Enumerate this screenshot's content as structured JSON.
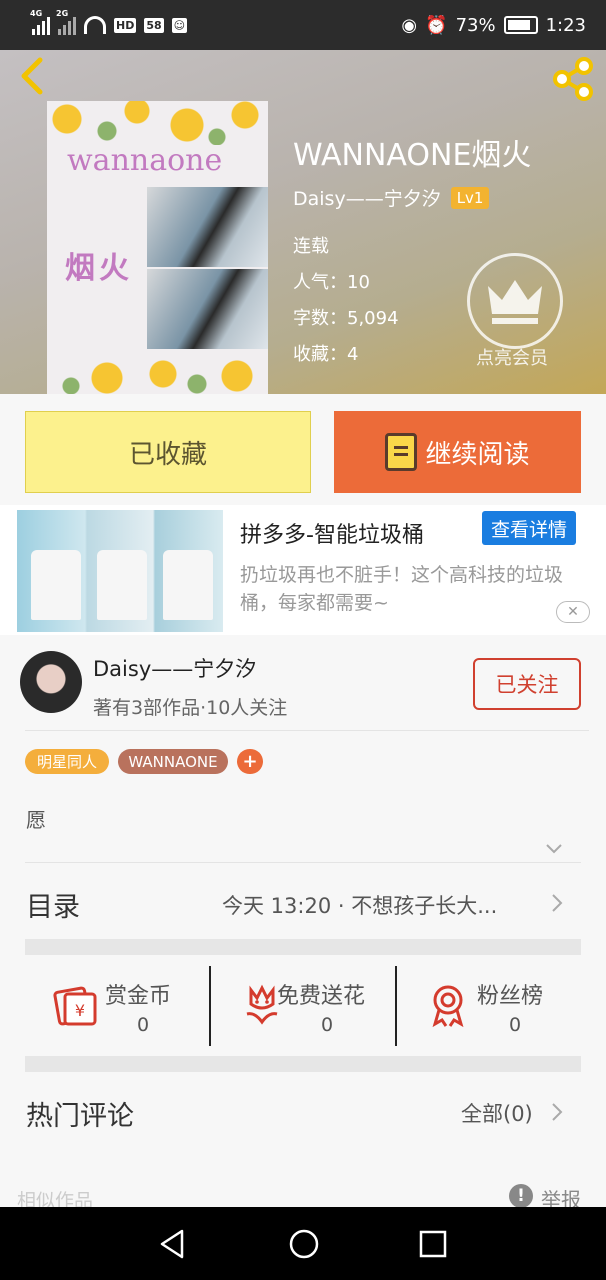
{
  "status_bar": {
    "net1": "4G",
    "net2": "2G",
    "hd": "HD",
    "app_badge": "58",
    "battery": "73%",
    "time": "1:23"
  },
  "book": {
    "title": "WANNAONE烟火",
    "author": "Daisy——宁夕汐",
    "level": "Lv1",
    "status": "连载",
    "popularity": "人气：10",
    "word_count": "字数：5,094",
    "favorites": "收藏：4",
    "cover_title": "wannaone",
    "cover_subtitle": "烟火",
    "vip_label": "点亮会员"
  },
  "actions": {
    "favorited": "已收藏",
    "continue_reading": "继续阅读"
  },
  "ad": {
    "title": "拼多多-智能垃圾桶",
    "cta": "查看详情",
    "description": "扔垃圾再也不脏手！这个高科技的垃圾桶，每家都需要~",
    "close": "✕"
  },
  "author_card": {
    "name": "Daisy——宁夕汐",
    "meta": "著有3部作品·10人关注",
    "follow": "已关注"
  },
  "tags": [
    "明星同人",
    "WANNAONE",
    "+"
  ],
  "intro": "愿",
  "catalog": {
    "label": "目录",
    "latest": "今天 13:20 · 不想孩子长大..."
  },
  "trio": [
    {
      "label": "赏金币",
      "count": "0",
      "icon": "reward-coin-icon"
    },
    {
      "label": "免费送花",
      "count": "0",
      "icon": "flower-icon"
    },
    {
      "label": "粉丝榜",
      "count": "0",
      "icon": "medal-icon"
    }
  ],
  "comments": {
    "label": "热门评论",
    "all": "全部(0)"
  },
  "footer": {
    "similar": "相似作品",
    "report": "举报"
  },
  "colors": {
    "accent_orange": "#ec6b39",
    "fav_yellow": "#fcf18d",
    "follow_red": "#d0402f",
    "ad_blue": "#1a7de0",
    "level_gold": "#f3b330"
  }
}
